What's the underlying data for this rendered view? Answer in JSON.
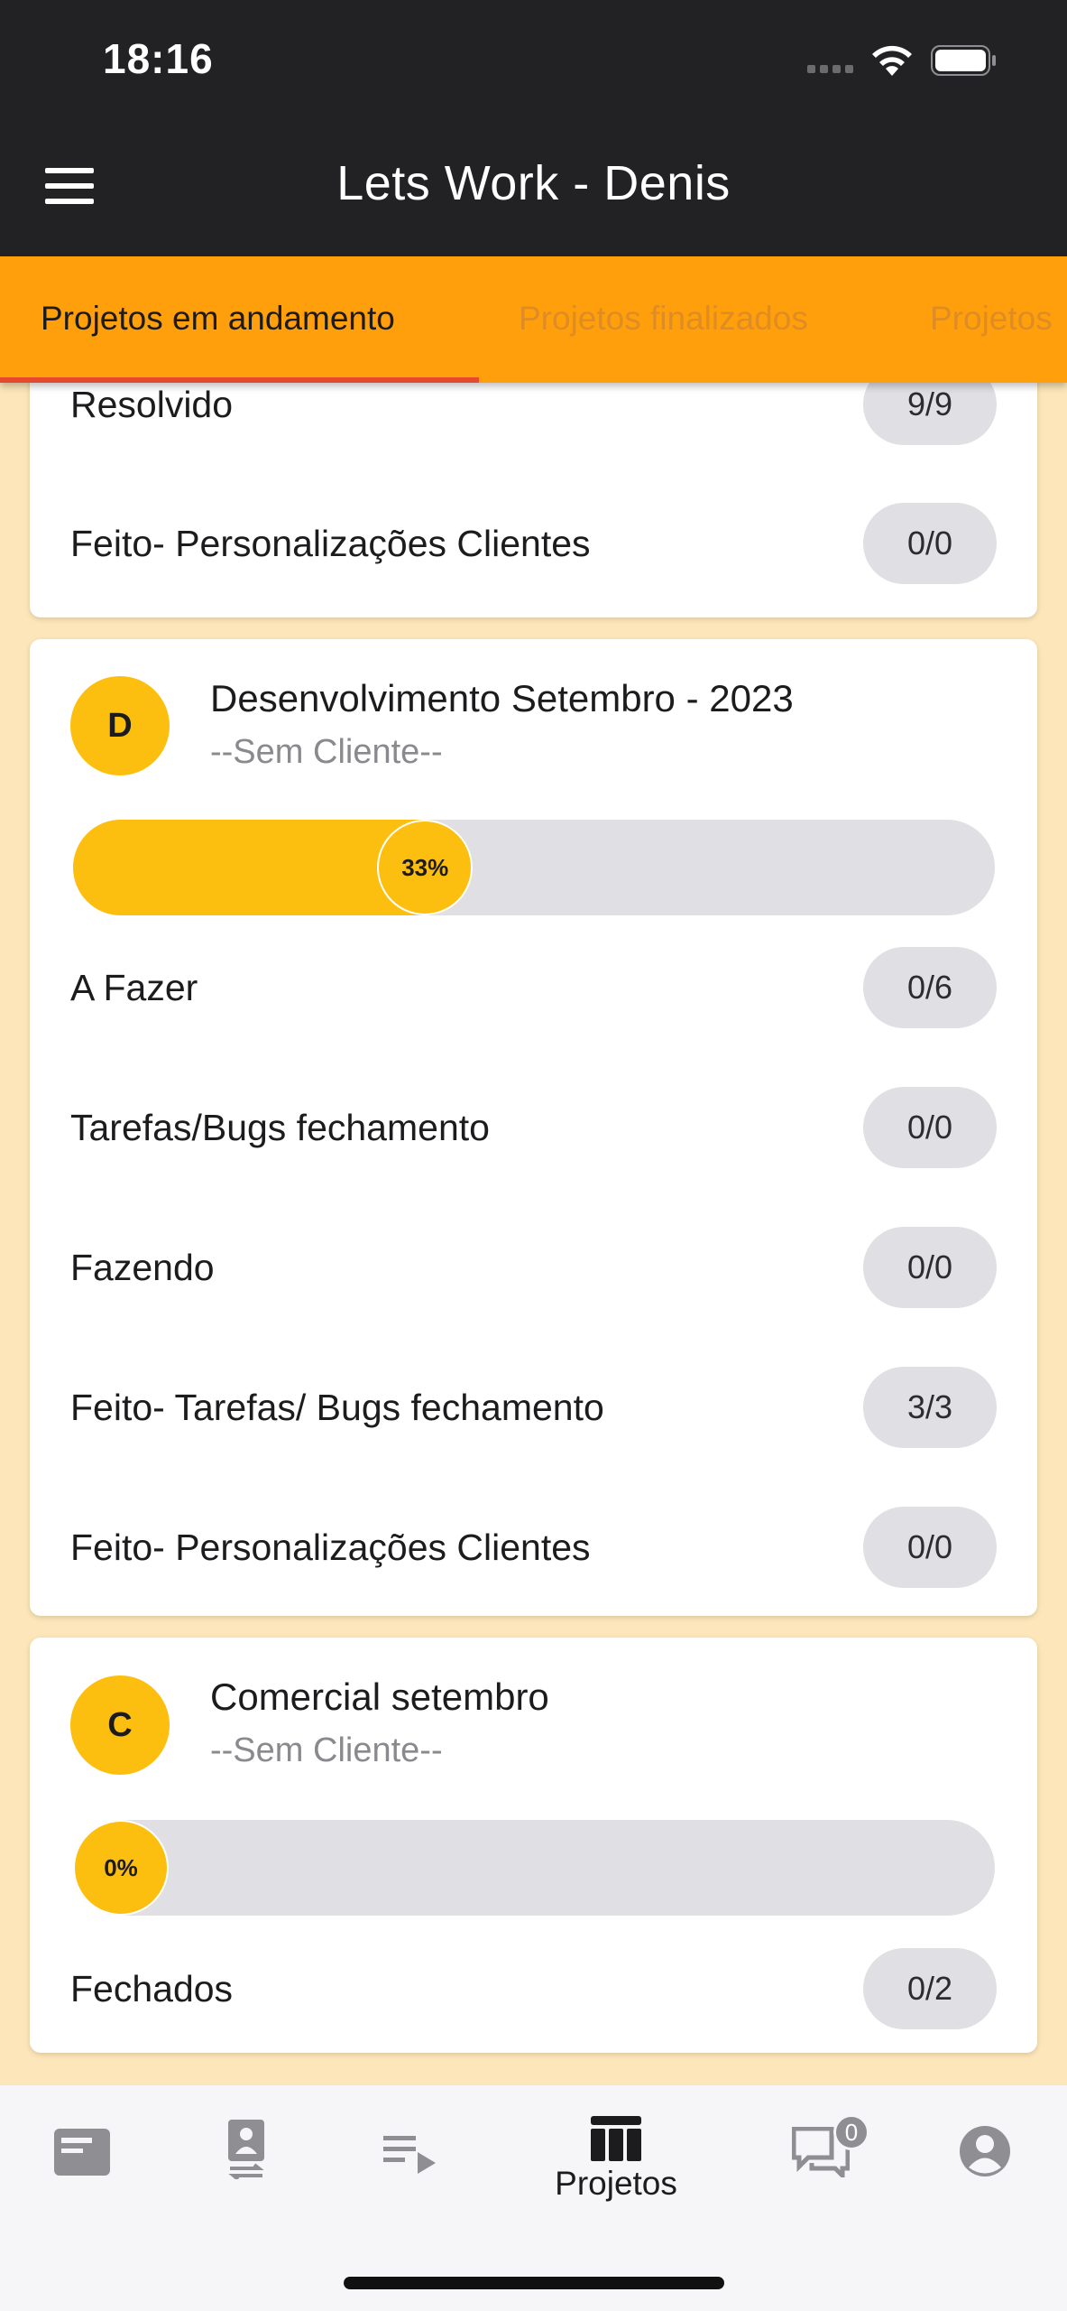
{
  "status_bar": {
    "time": "18:16"
  },
  "app_bar": {
    "title": "Lets Work - Denis"
  },
  "tabs": [
    {
      "label": "Projetos em andamento",
      "active": true
    },
    {
      "label": "Projetos finalizados",
      "active": false
    },
    {
      "label": "Projetos",
      "active": false
    }
  ],
  "cards": [
    {
      "rows": [
        {
          "label": "Resolvido",
          "count": "9/9"
        },
        {
          "label": "Feito- Personalizações Clientes",
          "count": "0/0"
        }
      ]
    },
    {
      "avatar": "D",
      "title": "Desenvolvimento Setembro - 2023",
      "subtitle": "--Sem Cliente--",
      "progress_label": "33%",
      "progress": 0.33,
      "rows": [
        {
          "label": "A Fazer",
          "count": "0/6"
        },
        {
          "label": "Tarefas/Bugs fechamento",
          "count": "0/0"
        },
        {
          "label": "Fazendo",
          "count": "0/0"
        },
        {
          "label": "Feito- Tarefas/ Bugs fechamento",
          "count": "3/3"
        },
        {
          "label": "Feito- Personalizações Clientes",
          "count": "0/0"
        }
      ]
    },
    {
      "avatar": "C",
      "title": "Comercial setembro",
      "subtitle": "--Sem Cliente--",
      "progress_label": "0%",
      "progress": 0,
      "rows": [
        {
          "label": "Fechados",
          "count": "0/2"
        }
      ]
    }
  ],
  "bottom_nav": {
    "items": [
      {
        "icon": "card-icon"
      },
      {
        "icon": "contact-transfer-icon"
      },
      {
        "icon": "playlist-icon"
      },
      {
        "icon": "table-icon",
        "label": "Projetos",
        "active": true
      },
      {
        "icon": "chat-icon",
        "badge": "0"
      },
      {
        "icon": "profile-icon"
      }
    ]
  },
  "colors": {
    "accent": "#ff9f0b",
    "progress": "#fdbf0f",
    "background": "#fde6b9",
    "appbar": "#222224"
  }
}
